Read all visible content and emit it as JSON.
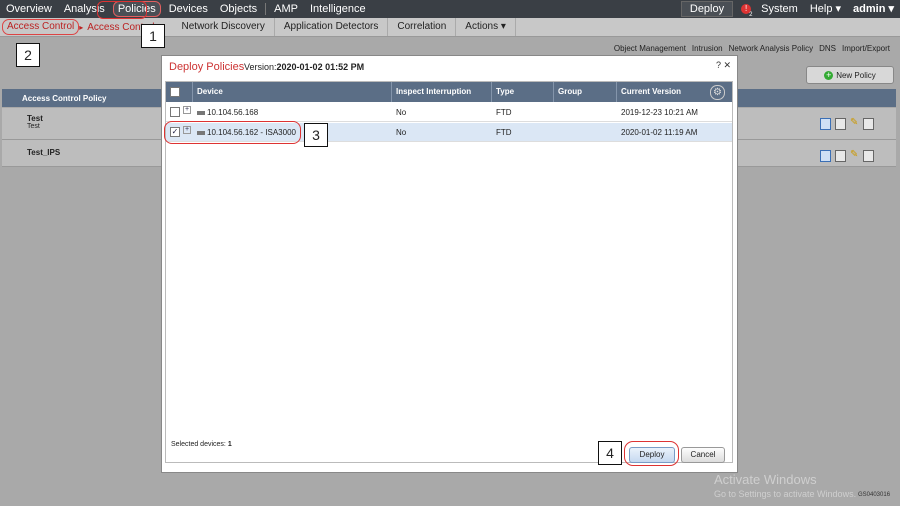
{
  "topnav": {
    "items": [
      "Overview",
      "Analysis",
      "Policies",
      "Devices",
      "Objects",
      "AMP",
      "Intelligence"
    ],
    "active_index": 2,
    "deploy_label": "Deploy",
    "alert_count": "2",
    "system_label": "System",
    "help_label": "Help ▾",
    "user_label": "admin ▾"
  },
  "secnav": {
    "breadcrumb_first": "Access Control",
    "breadcrumb_second": "Access Control",
    "items": [
      "Network Discovery",
      "Application Detectors",
      "Correlation",
      "Actions ▾"
    ]
  },
  "sublinks": [
    "Object Management",
    "Intrusion",
    "Network Analysis Policy",
    "DNS",
    "Import/Export"
  ],
  "new_policy_label": "New Policy",
  "background_table": {
    "header": "Access Control Policy",
    "rows": [
      {
        "name": "Test",
        "desc": "Test"
      },
      {
        "name": "Test_IPS",
        "desc": ""
      }
    ]
  },
  "modal": {
    "title": "Deploy Policies",
    "version_label": "Version:",
    "version_value": "2020-01-02 01:52 PM",
    "help_close": "?  ✕",
    "columns": [
      "Device",
      "Inspect Interruption",
      "Type",
      "Group",
      "Current Version"
    ],
    "rows": [
      {
        "device": "10.104.56.168",
        "inspect": "No",
        "type": "FTD",
        "group": "",
        "version": "2019-12-23 10:21 AM",
        "checked": false
      },
      {
        "device": "10.104.56.162 - ISA3000",
        "inspect": "No",
        "type": "FTD",
        "group": "",
        "version": "2020-01-02 11:19 AM",
        "checked": true
      }
    ],
    "selected_label": "Selected devices:",
    "selected_count": "1",
    "deploy_button": "Deploy",
    "cancel_button": "Cancel"
  },
  "callouts": [
    "1",
    "2",
    "3",
    "4"
  ],
  "watermark": {
    "line1": "Activate Windows",
    "line2": "Go to Settings to activate Windows."
  },
  "image_code": "GS0403016"
}
